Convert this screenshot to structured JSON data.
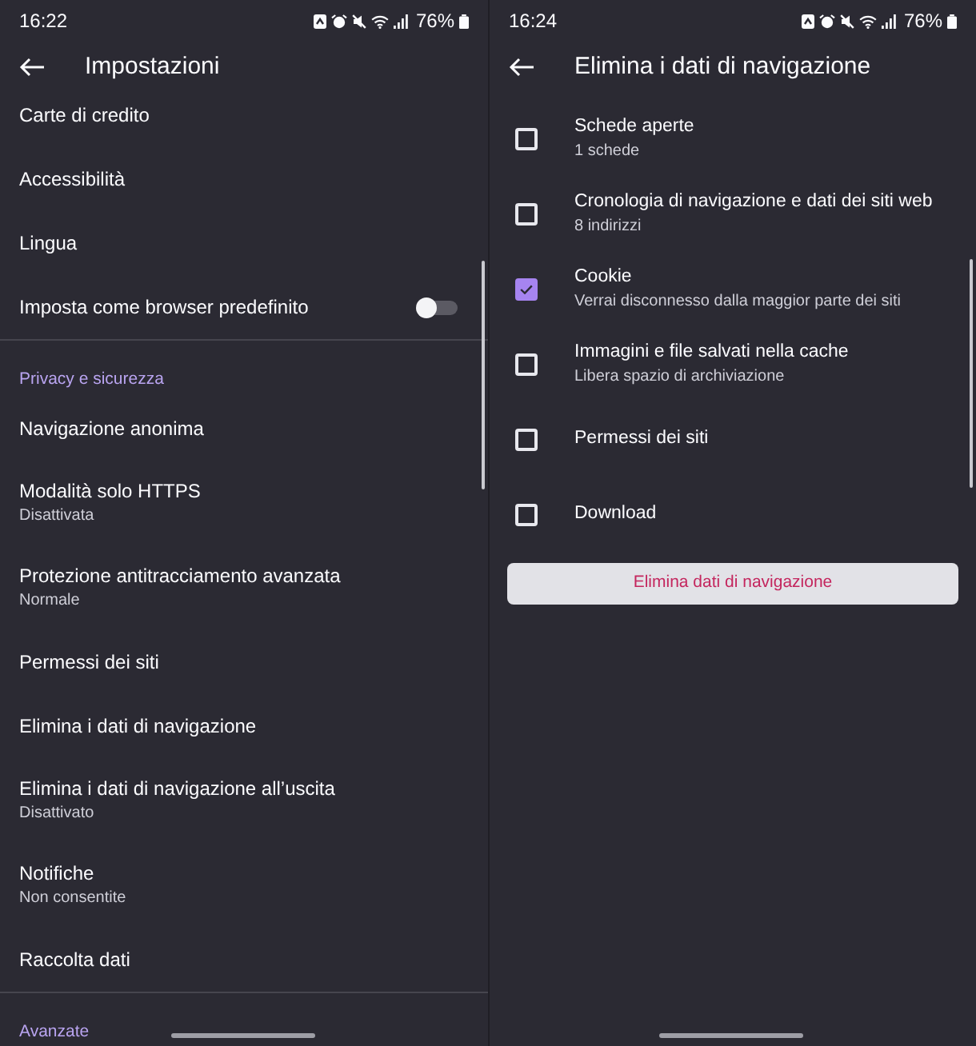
{
  "settings_screen": {
    "status_bar": {
      "time": "16:22",
      "battery": "76%"
    },
    "title": "Impostazioni",
    "rows": [
      {
        "kind": "item",
        "label": "Carte di credito"
      },
      {
        "kind": "item",
        "label": "Accessibilità"
      },
      {
        "kind": "item",
        "label": "Lingua"
      },
      {
        "kind": "toggle",
        "label": "Imposta come browser predefinito",
        "on": false
      },
      {
        "kind": "section",
        "label": "Privacy e sicurezza"
      },
      {
        "kind": "item",
        "label": "Navigazione anonima"
      },
      {
        "kind": "item",
        "label": "Modalità solo HTTPS",
        "detail": "Disattivata"
      },
      {
        "kind": "item",
        "label": "Protezione antitracciamento avanzata",
        "detail": "Normale"
      },
      {
        "kind": "item",
        "label": "Permessi dei siti"
      },
      {
        "kind": "item",
        "label": "Elimina i dati di navigazione"
      },
      {
        "kind": "item",
        "label": "Elimina i dati di navigazione all’uscita",
        "detail": "Disattivato"
      },
      {
        "kind": "item",
        "label": "Notifiche",
        "detail": "Non consentite"
      },
      {
        "kind": "item",
        "label": "Raccolta dati"
      },
      {
        "kind": "section",
        "label": "Avanzate"
      }
    ]
  },
  "clear_data_screen": {
    "status_bar": {
      "time": "16:24",
      "battery": "76%"
    },
    "title": "Elimina i dati di navigazione",
    "options": [
      {
        "label": "Schede aperte",
        "detail": "1 schede",
        "checked": false
      },
      {
        "label": "Cronologia di navigazione e dati dei siti web",
        "detail": "8 indirizzi",
        "checked": false
      },
      {
        "label": "Cookie",
        "detail": "Verrai disconnesso dalla maggior parte dei siti",
        "checked": true
      },
      {
        "label": "Immagini e file salvati nella cache",
        "detail": "Libera spazio di archiviazione",
        "checked": false
      },
      {
        "label": "Permessi dei siti",
        "checked": false
      },
      {
        "label": "Download",
        "checked": false
      }
    ],
    "button": "Elimina dati di navigazione"
  }
}
